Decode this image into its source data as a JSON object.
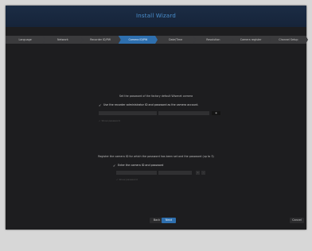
{
  "window": {
    "title": "Install Wizard"
  },
  "tabs": [
    {
      "label": "Language",
      "active": false
    },
    {
      "label": "Network",
      "active": false
    },
    {
      "label": "Recorder ID/PW",
      "active": false
    },
    {
      "label": "Camera ID/PW",
      "active": true
    },
    {
      "label": "Date/Time",
      "active": false
    },
    {
      "label": "Resolution",
      "active": false
    },
    {
      "label": "Camera register",
      "active": false
    },
    {
      "label": "Channel Setup",
      "active": false
    }
  ],
  "section1": {
    "message": "Set the password of the factory default Wisenet camera",
    "option_label": "Use the recorder administrator ID and password as the camera account.",
    "id_placeholder": "",
    "password_placeholder": "",
    "eye_label": "",
    "show_password_label": "Show password"
  },
  "section2": {
    "message": "Register the camera ID for which the password has been set and the password (up to 3)",
    "option_label": "Enter the camera ID and password",
    "id_placeholder": "",
    "password_placeholder": "",
    "add_label": "+",
    "remove_label": "-",
    "show_password_label": "Show password"
  },
  "footer": {
    "back_label": "Back",
    "next_label": "Next",
    "cancel_label": "Cancel"
  },
  "colors": {
    "accent": "#2e6fae",
    "title": "#4a8fcf",
    "panel": "#1d1d1f"
  }
}
